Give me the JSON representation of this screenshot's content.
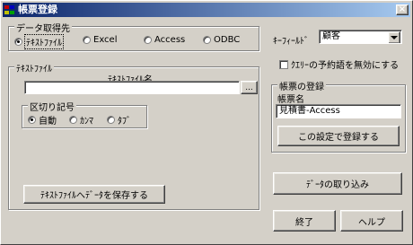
{
  "window": {
    "title": "帳票登録",
    "close_glyph": "×"
  },
  "data_source": {
    "legend": "データ取得先",
    "options": [
      {
        "label": "ﾃｷｽﾄﾌｧｲﾙ",
        "selected": true
      },
      {
        "label": "Excel",
        "selected": false
      },
      {
        "label": "Access",
        "selected": false
      },
      {
        "label": "ODBC",
        "selected": false
      }
    ]
  },
  "key_field": {
    "label": "ｷｰﾌｨｰﾙﾄﾞ",
    "value": "顧客"
  },
  "query_option": {
    "label": "ｸｴﾘｰの予約語を無効にする",
    "checked": false
  },
  "text_file": {
    "legend": "ﾃｷｽﾄﾌｧｲﾙ",
    "filename_label": "ﾃｷｽﾄﾌｧｲﾙ名",
    "filename_value": "",
    "browse_label": "...",
    "delimiter": {
      "legend": "区切り記号",
      "options": [
        {
          "label": "自動",
          "selected": true
        },
        {
          "label": "ｶﾝﾏ",
          "selected": false
        },
        {
          "label": "ﾀﾌﾞ",
          "selected": false
        }
      ]
    },
    "save_button": "ﾃｷｽﾄﾌｧｲﾙへﾃﾞｰﾀを保存する"
  },
  "form_register": {
    "legend": "帳票の登録",
    "name_label": "帳票名",
    "name_value": "見積書-Access",
    "register_button": "この設定で登録する"
  },
  "import_button": "ﾃﾞｰﾀの取り込み",
  "exit_button": "終了",
  "help_button": "ヘルプ",
  "colors": {
    "title_start": "#0a246a",
    "title_end": "#a6caf0",
    "face": "#d4d0c8"
  }
}
